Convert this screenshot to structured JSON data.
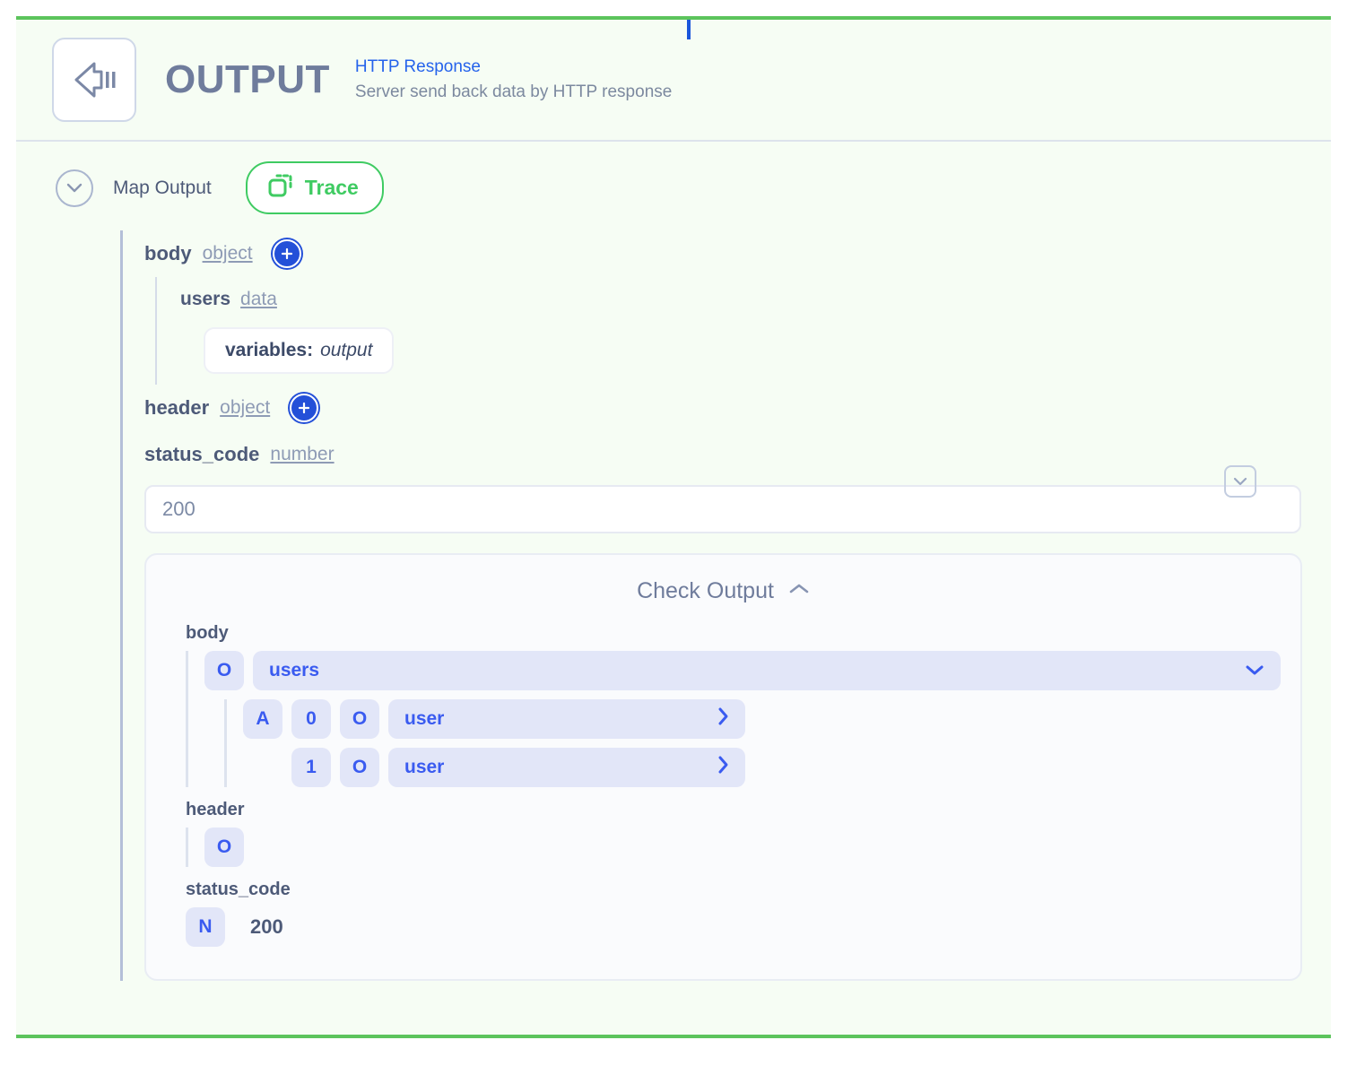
{
  "node": {
    "icon": "output-arrow-icon",
    "title": "OUTPUT",
    "subtitle": "HTTP Response",
    "description": "Server send back data by HTTP response",
    "accent_green": "#5cc45c",
    "accent_blue": "#2450d8",
    "background": "#f6fdf4"
  },
  "toolbar": {
    "map_output_label": "Map Output",
    "map_output_icon": "chevron-down-circle-icon",
    "trace_label": "Trace",
    "trace_icon": "trace-copy-icon",
    "trace_color": "#3fcb62"
  },
  "schema": {
    "collapse_icon": "chevron-down-icon",
    "fields": [
      {
        "name": "body",
        "type": "object",
        "add_icon": "plus-circle-icon",
        "children": [
          {
            "name": "users",
            "type": "data",
            "chip_key": "variables:",
            "chip_value": "output"
          }
        ]
      },
      {
        "name": "header",
        "type": "object",
        "add_icon": "plus-circle-icon"
      },
      {
        "name": "status_code",
        "type": "number",
        "value": "200"
      }
    ]
  },
  "check_output": {
    "title": "Check Output",
    "toggle_icon": "chevron-up-icon",
    "groups": [
      {
        "label": "body",
        "rows": [
          {
            "badges": [
              "O"
            ],
            "pill": "users",
            "pill_icon": "chevron-down-icon",
            "indent": 0
          },
          {
            "badges": [
              "A",
              "0",
              "O"
            ],
            "pill": "user",
            "pill_icon": "chevron-right-icon",
            "indent": 1
          },
          {
            "badges": [
              "1",
              "O"
            ],
            "pill": "user",
            "pill_icon": "chevron-right-icon",
            "indent": 1
          }
        ]
      },
      {
        "label": "header",
        "rows": [
          {
            "badges": [
              "O"
            ],
            "pill": null,
            "indent": 0
          }
        ]
      },
      {
        "label": "status_code",
        "rows": [
          {
            "badges": [
              "N"
            ],
            "plain_value": "200",
            "indent": 0
          }
        ]
      }
    ]
  }
}
